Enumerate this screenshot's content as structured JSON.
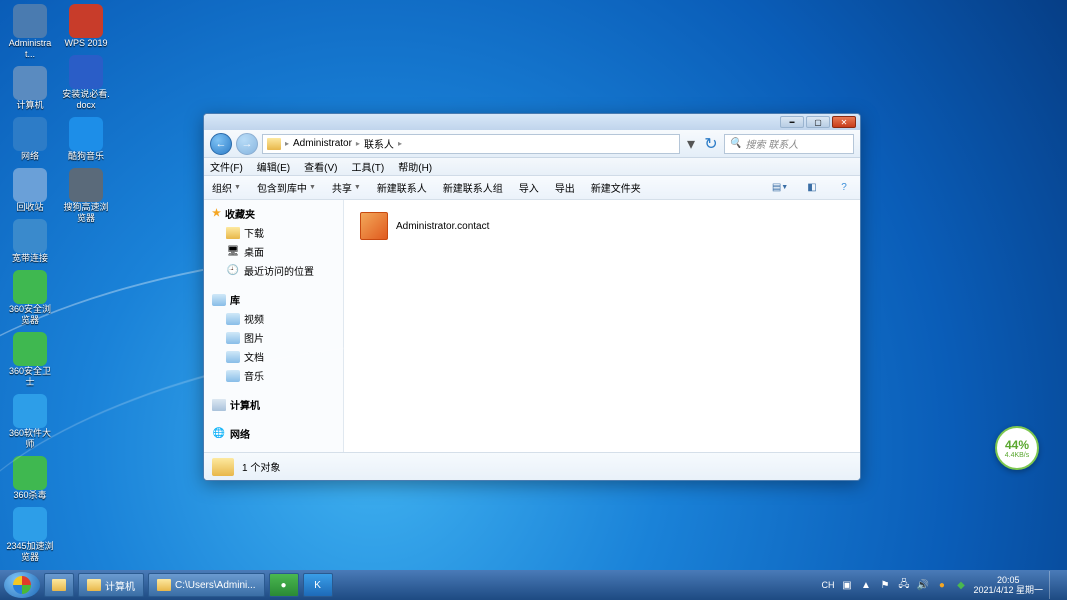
{
  "desktop": {
    "col1": [
      {
        "label": "Administrat...",
        "icon": "computer",
        "bg": "#4a7bb0"
      },
      {
        "label": "计算机",
        "icon": "pc",
        "bg": "#5a8bc0"
      },
      {
        "label": "网络",
        "icon": "net",
        "bg": "#2d7cc7"
      },
      {
        "label": "回收站",
        "icon": "bin",
        "bg": "#6aa0d8"
      },
      {
        "label": "宽带连接",
        "icon": "conn",
        "bg": "#3a8acc"
      },
      {
        "label": "360安全浏览器",
        "icon": "360b",
        "bg": "#3fb850"
      },
      {
        "label": "360安全卫士",
        "icon": "360s",
        "bg": "#3fb850"
      },
      {
        "label": "360软件大师",
        "icon": "360m",
        "bg": "#2d9ee8"
      },
      {
        "label": "360杀毒",
        "icon": "360k",
        "bg": "#3fb850"
      },
      {
        "label": "2345加速浏览器",
        "icon": "2345",
        "bg": "#2d9ee8"
      }
    ],
    "col2": [
      {
        "label": "WPS 2019",
        "icon": "wps",
        "bg": "#c83c2a"
      },
      {
        "label": "安装说必看.docx",
        "icon": "doc",
        "bg": "#2a5dc7"
      },
      {
        "label": "酷狗音乐",
        "icon": "kugou",
        "bg": "#1d8ee8"
      },
      {
        "label": "搜狗高速浏览器",
        "icon": "sogou",
        "bg": "#5a6a7a"
      }
    ]
  },
  "battery": {
    "pct": "44%",
    "unit": "4.4KB/s"
  },
  "win": {
    "nav": {
      "back": "←",
      "fwd": "→"
    },
    "addr": {
      "seg1": "Administrator",
      "seg2": "联系人"
    },
    "search_placeholder": "搜索 联系人",
    "menu": [
      "文件(F)",
      "编辑(E)",
      "查看(V)",
      "工具(T)",
      "帮助(H)"
    ],
    "toolbar": {
      "org": "组织",
      "inc": "包含到库中",
      "share": "共享",
      "newc": "新建联系人",
      "newg": "新建联系人组",
      "imp": "导入",
      "exp": "导出",
      "newf": "新建文件夹"
    },
    "sidebar": {
      "fav": {
        "head": "收藏夹",
        "items": [
          "下载",
          "桌面",
          "最近访问的位置"
        ]
      },
      "lib": {
        "head": "库",
        "items": [
          "视频",
          "图片",
          "文档",
          "音乐"
        ]
      },
      "computer": "计算机",
      "network": "网络"
    },
    "file": {
      "name": "Administrator.contact"
    },
    "status": "1 个对象"
  },
  "taskbar": {
    "btn1": "计算机",
    "btn2": "C:\\Users\\Admini...",
    "ime": "CH",
    "time": "20:05",
    "date": "2021/4/12 星期一"
  }
}
